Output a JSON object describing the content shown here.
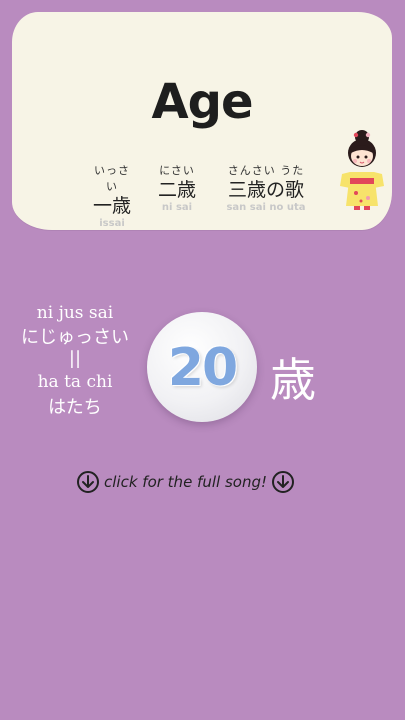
{
  "card": {
    "title": "Age",
    "lyrics": [
      {
        "kana": "いっさい",
        "kanji": "一歳",
        "romaji": "issai"
      },
      {
        "kana": "にさい",
        "kanji": "二歳",
        "romaji": "ni sai"
      },
      {
        "kana": "さんさい うた",
        "kanji": "三歳の歌",
        "romaji": "san sai  no  uta"
      }
    ]
  },
  "reading": {
    "romaji_1": "ni jus sai",
    "kana_1": "にじゅっさい",
    "separator": "||",
    "romaji_2": "ha ta chi",
    "kana_2": "はたち"
  },
  "number": "20",
  "sai": "歳",
  "song_link": {
    "label": "click for the full song!",
    "icon": "arrow-down-circle-icon"
  },
  "colors": {
    "background": "#b98bbf",
    "card": "#f7f4e6",
    "number": "#7fa7df"
  }
}
